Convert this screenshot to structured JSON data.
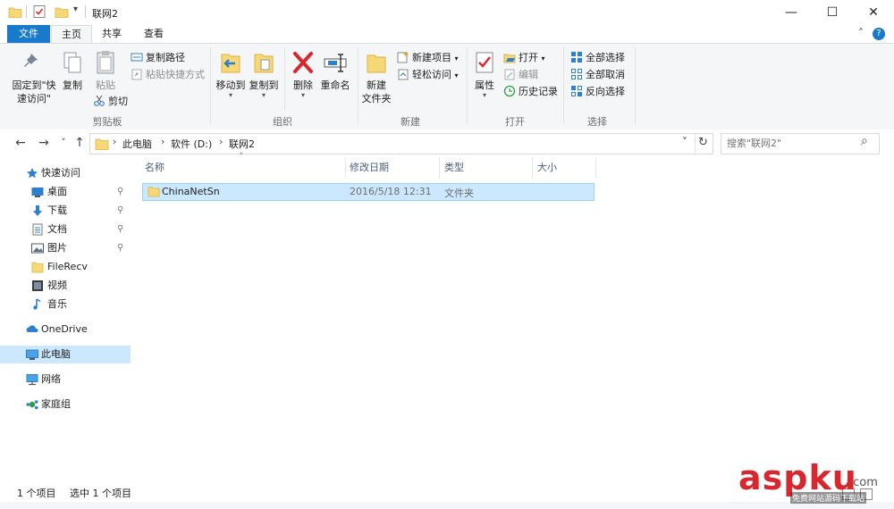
{
  "window": {
    "title": "联网2",
    "controls": {
      "minimize": "—",
      "maximize": "☐",
      "close": "✕"
    }
  },
  "quick_access_toolbar": {
    "dropdown_glyph": "▾",
    "icons": [
      "folder-icon",
      "properties-icon",
      "new-folder-icon"
    ]
  },
  "ribbon_tabs": [
    {
      "label": "文件",
      "active": false
    },
    {
      "label": "主页",
      "active": true
    },
    {
      "label": "共享",
      "active": false
    },
    {
      "label": "查看",
      "active": false
    }
  ],
  "help_glyph": "?",
  "collapse_glyph": "˄",
  "ribbon": {
    "clipboard": {
      "label": "剪贴板",
      "pin_line1": "固定到\"快",
      "pin_line2": "速访问\"",
      "copy": "复制",
      "paste": "粘贴",
      "copy_path": "复制路径",
      "paste_shortcut": "粘贴快捷方式",
      "cut": "剪切"
    },
    "organize": {
      "label": "组织",
      "move_to": "移动到",
      "copy_to": "复制到",
      "delete": "删除",
      "rename": "重命名"
    },
    "new": {
      "label": "新建",
      "new_folder_line1": "新建",
      "new_folder_line2": "文件夹",
      "new_item": "新建项目",
      "easy_access": "轻松访问"
    },
    "open": {
      "label": "打开",
      "properties": "属性",
      "open": "打开",
      "edit": "编辑",
      "history": "历史记录"
    },
    "select": {
      "label": "选择",
      "select_all": "全部选择",
      "select_none": "全部取消",
      "invert": "反向选择"
    },
    "dropdown_glyph": "▾"
  },
  "navigation": {
    "back": "←",
    "forward": "→",
    "recent": "˅",
    "up": "↑",
    "breadcrumb": [
      "此电脑",
      "软件 (D:)",
      "联网2"
    ],
    "breadcrumb_sep": "›",
    "address_dropdown": "˅",
    "refresh": "↻",
    "search_placeholder": "搜索\"联网2\"",
    "search_icon": "⌕"
  },
  "nav_pane": {
    "quick_access": "快速访问",
    "pinned": [
      {
        "label": "桌面",
        "icon": "desktop-icon",
        "pinned": true
      },
      {
        "label": "下载",
        "icon": "downloads-icon",
        "pinned": true
      },
      {
        "label": "文档",
        "icon": "documents-icon",
        "pinned": true
      },
      {
        "label": "图片",
        "icon": "pictures-icon",
        "pinned": true
      },
      {
        "label": "FileRecv",
        "icon": "folder-icon",
        "pinned": false
      },
      {
        "label": "视频",
        "icon": "videos-icon",
        "pinned": false
      },
      {
        "label": "音乐",
        "icon": "music-icon",
        "pinned": false
      }
    ],
    "pin_glyph": "📌",
    "onedrive": "OneDrive",
    "this_pc": "此电脑",
    "network": "网络",
    "homegroup": "家庭组"
  },
  "file_list": {
    "columns": {
      "name": "名称",
      "modified": "修改日期",
      "type": "类型",
      "size": "大小"
    },
    "sort_glyph": "˄",
    "rows": [
      {
        "name": "ChinaNetSn",
        "modified": "2016/5/18 12:31",
        "type": "文件夹",
        "size": ""
      }
    ]
  },
  "status": {
    "item_count": "1 个项目",
    "selected": "选中 1 个项目"
  },
  "colors": {
    "file_tab": "#1979ca",
    "selection_bg": "#cce8ff",
    "selection_border": "#99d1ff",
    "folder_yellow": "#f8d775",
    "ribbon_bg": "#f5f6f7"
  },
  "watermark": {
    "brand": "aspku",
    "domain": ".com",
    "tagline": "免费网站源码下载站"
  }
}
